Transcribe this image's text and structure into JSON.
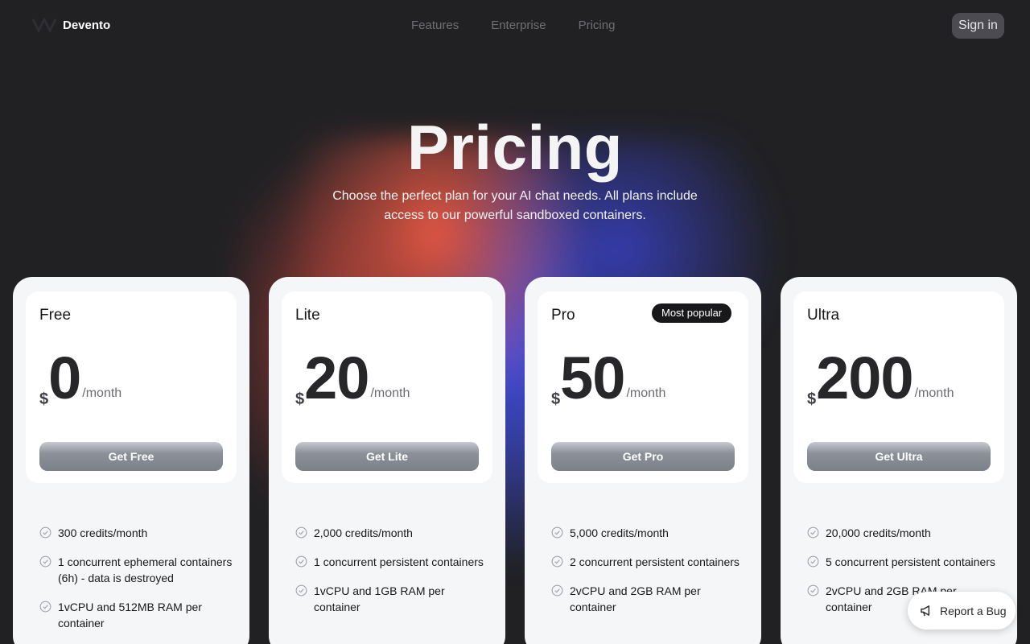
{
  "header": {
    "brand": "Devento",
    "nav": [
      "Features",
      "Enterprise",
      "Pricing"
    ],
    "sign_in": "Sign in"
  },
  "hero": {
    "title": "Pricing",
    "subtitle": "Choose the perfect plan for your AI chat needs. All plans include access to our powerful sandboxed containers."
  },
  "plans": [
    {
      "name": "Free",
      "currency": "$",
      "amount": "0",
      "period": "/month",
      "button": "Get Free",
      "features": [
        "300 credits/month",
        "1 concurrent ephemeral containers (6h) - data is destroyed",
        "1vCPU and 512MB RAM per container"
      ]
    },
    {
      "name": "Lite",
      "currency": "$",
      "amount": "20",
      "period": "/month",
      "button": "Get Lite",
      "features": [
        "2,000 credits/month",
        "1 concurrent persistent containers",
        "1vCPU and 1GB RAM per container"
      ]
    },
    {
      "name": "Pro",
      "currency": "$",
      "amount": "50",
      "period": "/month",
      "button": "Get Pro",
      "badge": "Most popular",
      "features": [
        "5,000 credits/month",
        "2 concurrent persistent containers",
        "2vCPU and 2GB RAM per container"
      ]
    },
    {
      "name": "Ultra",
      "currency": "$",
      "amount": "200",
      "period": "/month",
      "button": "Get Ultra",
      "features": [
        "20,000 credits/month",
        "5 concurrent persistent containers",
        "2vCPU and 2GB RAM per container"
      ]
    }
  ],
  "report_bug": "Report a Bug",
  "icons": {
    "logo": "devento-logo",
    "check": "check-circle-icon",
    "bug": "megaphone-icon"
  }
}
